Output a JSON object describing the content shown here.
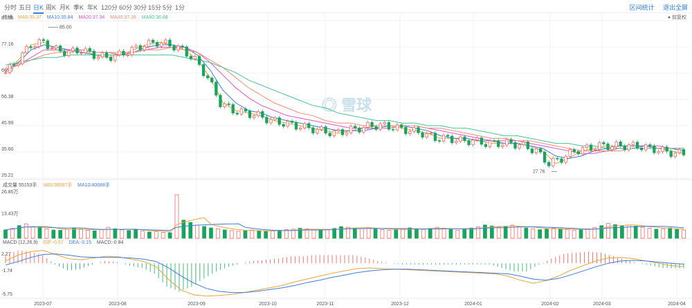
{
  "tabs": [
    "分时",
    "五日",
    "日K",
    "周K",
    "月K",
    "季K",
    "年K",
    "120分",
    "60分",
    "30分",
    "15分",
    "5分",
    "1分"
  ],
  "active_tab": 2,
  "toolbar": {
    "stats_label": "区间统计",
    "fullscreen_label": "退出全屏"
  },
  "adjust_label": "前复权",
  "watermark": "雪球",
  "colors": {
    "up": "#f2574f",
    "down": "#19a35c",
    "ma5": "#f0a33a",
    "ma10": "#3a7dde",
    "ma20": "#e352c8",
    "ma30": "#f58d72",
    "ma60": "#48c29a"
  },
  "price_legend": {
    "title": "均线",
    "ma5": "MA5:35.37",
    "ma10": "MA10:35.84",
    "ma20": "MA20:37.34",
    "ma30": "MA30:37.38",
    "ma60": "MA60:36.68"
  },
  "volume_legend": {
    "title": "成交量 55153手",
    "ma5": "MA5:58587手",
    "ma10": "MA10:40688手"
  },
  "macd_legend": {
    "title": "MACD (12,26,9)",
    "dif": "DIF:-0.57",
    "dea": "DEA:-0.15",
    "macd": "MACD:-0.84"
  },
  "chart_data": [
    {
      "type": "candlestick",
      "title": "",
      "y_ticks": [
        "87.55",
        "77.16",
        "66.77",
        "56.38",
        "45.99",
        "35.60",
        "25.21"
      ],
      "ylim": [
        25.21,
        87.55
      ],
      "x_ticks": [
        "2023-07",
        "2023-08",
        "2023-09",
        "2023-10",
        "2023-11",
        "2023-12",
        "2024-01",
        "2024-02",
        "2024-03",
        "2024-04"
      ],
      "annotations": [
        {
          "label": "85.00",
          "type": "high"
        },
        {
          "label": "27.76",
          "type": "low"
        }
      ],
      "series": [
        {
          "name": "MA5",
          "values": [
            67,
            72,
            78,
            79,
            76,
            75,
            76,
            74,
            73,
            74,
            76,
            78,
            79,
            78,
            76,
            72,
            65,
            55,
            52,
            51,
            50,
            48,
            47,
            46,
            45,
            44,
            43,
            44,
            45,
            46,
            46,
            45,
            44,
            43,
            41,
            41,
            40,
            40,
            39,
            39,
            39,
            38,
            36,
            31,
            33,
            36,
            37,
            38,
            38,
            38,
            38,
            37,
            36,
            35
          ]
        },
        {
          "name": "MA10",
          "values": [
            68,
            71,
            76,
            78,
            77,
            76,
            75,
            74,
            74,
            74,
            75,
            77,
            78,
            78,
            77,
            74,
            68,
            60,
            55,
            52,
            51,
            49,
            48,
            47,
            46,
            45,
            44,
            44,
            44,
            45,
            46,
            46,
            45,
            44,
            42,
            41,
            41,
            40,
            40,
            39,
            39,
            38,
            37,
            34,
            33,
            34,
            36,
            37,
            38,
            38,
            38,
            37,
            37,
            36
          ]
        },
        {
          "name": "MA20",
          "values": [
            68,
            70,
            73,
            76,
            76,
            76,
            76,
            75,
            75,
            74,
            75,
            76,
            77,
            77,
            77,
            75,
            71,
            66,
            61,
            57,
            54,
            52,
            50,
            49,
            48,
            47,
            46,
            45,
            45,
            45,
            45,
            46,
            46,
            45,
            44,
            43,
            42,
            41,
            40,
            40,
            40,
            39,
            38,
            37,
            36,
            35,
            35,
            36,
            37,
            37,
            38,
            38,
            37,
            37
          ]
        },
        {
          "name": "MA30",
          "values": [
            69,
            70,
            72,
            74,
            75,
            75,
            76,
            75,
            75,
            75,
            75,
            76,
            76,
            77,
            76,
            75,
            72,
            69,
            65,
            61,
            58,
            55,
            53,
            51,
            50,
            48,
            47,
            47,
            46,
            46,
            46,
            46,
            46,
            45,
            45,
            44,
            43,
            42,
            41,
            41,
            40,
            40,
            39,
            38,
            37,
            36,
            36,
            36,
            36,
            37,
            37,
            37,
            37,
            37
          ]
        },
        {
          "name": "MA60",
          "values": [
            70,
            71,
            72,
            73,
            73,
            74,
            74,
            74,
            74,
            74,
            74,
            74,
            74,
            74,
            73,
            72,
            71,
            69,
            67,
            64,
            62,
            60,
            58,
            56,
            54,
            53,
            51,
            50,
            49,
            48,
            48,
            47,
            47,
            46,
            46,
            45,
            45,
            44,
            43,
            42,
            42,
            41,
            40,
            39,
            39,
            38,
            38,
            37,
            37,
            37,
            37,
            37,
            37,
            37
          ]
        }
      ]
    },
    {
      "type": "bar",
      "title": "",
      "y_ticks": [
        "26.85万",
        "13.43万"
      ],
      "ylim": [
        0,
        26.85
      ],
      "values": [
        5.2,
        6.1,
        7.8,
        8.9,
        7.2,
        6.5,
        5.8,
        5.1,
        4.9,
        5.4,
        6.2,
        5.7,
        5.0,
        4.6,
        5.3,
        6.8,
        5.9,
        5.2,
        4.8,
        5.5,
        4.4,
        3.9,
        4.2,
        3.6,
        3.4,
        26.85,
        11.2,
        9.8,
        8.1,
        7.3,
        6.4,
        5.8,
        5.2,
        4.7,
        4.3,
        4.6,
        5.1,
        4.8,
        4.2,
        4.5,
        4.9,
        5.3,
        5.6,
        6.2,
        5.8,
        5.1,
        4.9,
        5.4,
        6.1,
        7.2,
        6.8,
        6.3,
        5.9,
        6.6,
        5.7,
        5.3,
        4.9,
        5.2,
        5.8,
        6.4,
        5.9,
        5.5,
        6.1,
        6.8,
        6.2,
        5.4,
        5.0,
        5.6,
        6.3,
        7.1,
        8.2,
        7.6,
        6.9,
        7.4,
        8.1,
        7.0,
        6.4,
        5.8,
        5.3,
        5.7,
        6.2,
        5.9,
        5.4,
        4.8,
        5.2,
        5.8,
        6.6,
        7.8,
        9.1,
        8.4,
        7.6,
        8.2,
        7.5,
        6.8,
        6.2,
        5.6,
        5.9,
        6.4,
        5.5,
        5.1
      ]
    },
    {
      "type": "line",
      "title": "",
      "y_ticks": [
        "2.27",
        "-1.74",
        "-5.75"
      ],
      "ylim": [
        -5.75,
        2.27
      ],
      "series": [
        {
          "name": "DIF",
          "values": [
            0.4,
            1.4,
            2.0,
            2.2,
            1.5,
            0.8,
            0.6,
            0.9,
            1.2,
            1.1,
            0.7,
            0.3,
            -0.6,
            -2.8,
            -4.6,
            -5.4,
            -5.6,
            -5.5,
            -5.3,
            -5.0,
            -4.6,
            -4.2,
            -3.8,
            -3.2,
            -2.7,
            -2.2,
            -1.7,
            -1.3,
            -0.9,
            -0.8,
            -0.9,
            -1.0,
            -1.1,
            -1.2,
            -1.3,
            -1.4,
            -1.5,
            -1.6,
            -1.7,
            -1.8,
            -2.2,
            -2.9,
            -3.4,
            -3.0,
            -2.2,
            -1.2,
            -0.4,
            0.4,
            0.9,
            1.0,
            0.8,
            0.4,
            0.0,
            -0.4,
            -0.57
          ]
        },
        {
          "name": "DEA",
          "values": [
            -0.3,
            0.3,
            1.0,
            1.5,
            1.6,
            1.4,
            1.1,
            1.0,
            1.0,
            1.0,
            0.9,
            0.7,
            0.3,
            -0.8,
            -2.2,
            -3.4,
            -4.3,
            -4.8,
            -5.0,
            -5.0,
            -4.8,
            -4.5,
            -4.2,
            -3.8,
            -3.3,
            -2.9,
            -2.4,
            -2.0,
            -1.6,
            -1.3,
            -1.1,
            -1.0,
            -1.0,
            -1.1,
            -1.2,
            -1.3,
            -1.4,
            -1.5,
            -1.6,
            -1.7,
            -1.8,
            -2.2,
            -2.7,
            -2.9,
            -2.6,
            -2.0,
            -1.3,
            -0.6,
            0.0,
            0.4,
            0.5,
            0.4,
            0.2,
            0.0,
            -0.15
          ]
        }
      ]
    }
  ]
}
